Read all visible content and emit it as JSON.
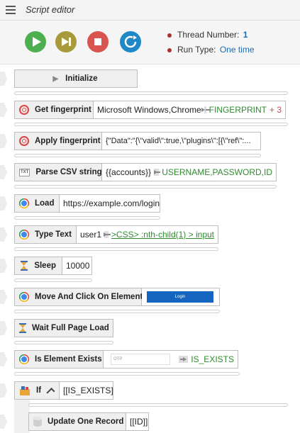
{
  "app": {
    "title": "Script editor"
  },
  "controls": {
    "play": "play-icon",
    "step": "step-forward-icon",
    "stop": "stop-icon",
    "reload": "reload-icon",
    "thread_label": "Thread Number:",
    "thread_value": "1",
    "run_label": "Run Type:",
    "run_value": "One time"
  },
  "steps": [
    {
      "name": "Initialize"
    },
    {
      "name": "Get fingerprint",
      "param": "Microsoft Windows,Chrome",
      "out": "FINGERPRINT",
      "extra": "+ 3"
    },
    {
      "name": "Apply fingerprint",
      "param": "{\"Data\":\"{\\\"valid\\\":true,\\\"plugins\\\":[{\\\"ref\\\":..."
    },
    {
      "name": "Parse CSV string",
      "param": "{{accounts}}",
      "out": "USERNAME,PASSWORD,ID"
    },
    {
      "name": "Load",
      "param": "https://example.com/login"
    },
    {
      "name": "Type Text",
      "param": "user1",
      "out": ">CSS> :nth-child(1) > input"
    },
    {
      "name": "Sleep",
      "param": "10000"
    },
    {
      "name": "Move And Click On Element",
      "button_text": "Login"
    },
    {
      "name": "Wait Full Page Load"
    },
    {
      "name": "Is Element Exists",
      "ghost": "OTP",
      "out": "IS_EXISTS"
    },
    {
      "name": "If",
      "param": "[[IS_EXISTS]]"
    },
    {
      "name": "Update One Record",
      "param": "[[ID]]"
    }
  ],
  "colors": {
    "play": "#4caf50",
    "step": "#a89a3a",
    "stop": "#d9534f",
    "reload": "#1e88c8",
    "accent": "#1a6bb3"
  }
}
